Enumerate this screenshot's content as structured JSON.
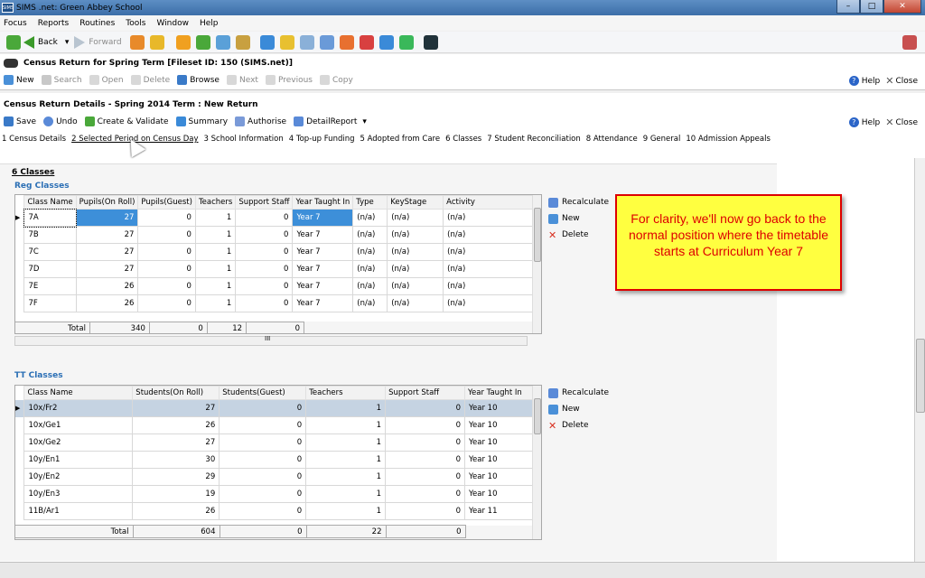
{
  "window": {
    "app_label": "SIMS",
    "title": "SIMS .net: Green Abbey School"
  },
  "menu": [
    "Focus",
    "Reports",
    "Routines",
    "Tools",
    "Window",
    "Help"
  ],
  "nav": {
    "back": "Back",
    "forward": "Forward"
  },
  "record": {
    "title": "Census Return for Spring Term [Fileset ID:  150 (SIMS.net)]",
    "tools": [
      "New",
      "Search",
      "Open",
      "Delete",
      "Browse",
      "Next",
      "Previous",
      "Copy"
    ],
    "help": "Help",
    "close": "Close"
  },
  "details": {
    "title": "Census Return Details - Spring 2014 Term : New Return",
    "tools": [
      "Save",
      "Undo",
      "Create & Validate",
      "Summary",
      "Authorise",
      "DetailReport"
    ],
    "help": "Help",
    "close": "Close",
    "tabs": [
      "1 Census Details",
      "2 Selected Period on Census Day",
      "3 School Information",
      "4 Top-up Funding",
      "5 Adopted from Care",
      "6 Classes",
      "7 Student Reconciliation",
      "8 Attendance",
      "9 General",
      "10 Admission Appeals"
    ]
  },
  "section": {
    "title": "6 Classes",
    "reg_title": "Reg Classes",
    "tt_title": "TT Classes"
  },
  "reg": {
    "headers": [
      "Class Name",
      "Pupils(On Roll)",
      "Pupils(Guest)",
      "Teachers",
      "Support Staff",
      "Year Taught In",
      "Type",
      "KeyStage",
      "Activity"
    ],
    "rows": [
      [
        "7A",
        "27",
        "0",
        "1",
        "0",
        "Year 7",
        "(n/a)",
        "(n/a)",
        "(n/a)"
      ],
      [
        "7B",
        "27",
        "0",
        "1",
        "0",
        "Year 7",
        "(n/a)",
        "(n/a)",
        "(n/a)"
      ],
      [
        "7C",
        "27",
        "0",
        "1",
        "0",
        "Year 7",
        "(n/a)",
        "(n/a)",
        "(n/a)"
      ],
      [
        "7D",
        "27",
        "0",
        "1",
        "0",
        "Year 7",
        "(n/a)",
        "(n/a)",
        "(n/a)"
      ],
      [
        "7E",
        "26",
        "0",
        "1",
        "0",
        "Year 7",
        "(n/a)",
        "(n/a)",
        "(n/a)"
      ],
      [
        "7F",
        "26",
        "0",
        "1",
        "0",
        "Year 7",
        "(n/a)",
        "(n/a)",
        "(n/a)"
      ]
    ],
    "total_label": "Total",
    "totals": [
      "340",
      "0",
      "12",
      "0"
    ],
    "scroll_label": "III"
  },
  "tt": {
    "headers": [
      "Class Name",
      "Students(On Roll)",
      "Students(Guest)",
      "Teachers",
      "Support Staff",
      "Year Taught In"
    ],
    "rows": [
      [
        "10x/Fr2",
        "27",
        "0",
        "1",
        "0",
        "Year 10"
      ],
      [
        "10x/Ge1",
        "26",
        "0",
        "1",
        "0",
        "Year 10"
      ],
      [
        "10x/Ge2",
        "27",
        "0",
        "1",
        "0",
        "Year 10"
      ],
      [
        "10y/En1",
        "30",
        "0",
        "1",
        "0",
        "Year 10"
      ],
      [
        "10y/En2",
        "29",
        "0",
        "1",
        "0",
        "Year 10"
      ],
      [
        "10y/En3",
        "19",
        "0",
        "1",
        "0",
        "Year 10"
      ],
      [
        "11B/Ar1",
        "26",
        "0",
        "1",
        "0",
        "Year 11"
      ]
    ],
    "total_label": "Total",
    "totals": [
      "604",
      "0",
      "22",
      "0"
    ]
  },
  "actions": {
    "recalculate": "Recalculate",
    "new": "New",
    "delete": "Delete"
  },
  "callout": "For clarity, we'll now go back to the normal position where the timetable starts at Curriculum Year 7"
}
